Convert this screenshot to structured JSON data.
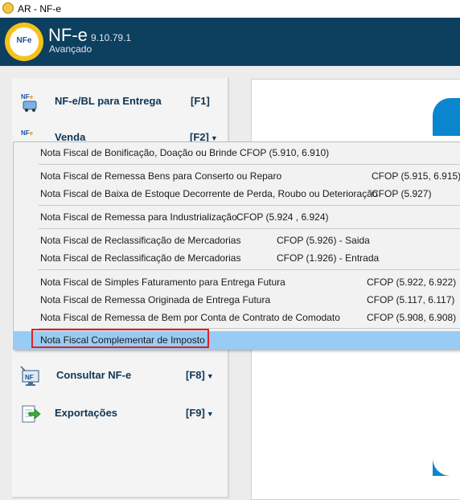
{
  "window": {
    "title": "AR - NF-e"
  },
  "header": {
    "app_name": "NF-e",
    "version": "9.10.79.1",
    "subtitle": "Avançado",
    "logo_text": "NFe"
  },
  "sidebar": {
    "items": [
      {
        "label": "NF-e/BL para Entrega",
        "key": "[F1]",
        "icon": "nfe-delivery-icon"
      },
      {
        "label": "Venda",
        "key": "[F2]",
        "icon": "nfe-sale-icon"
      },
      {
        "label": "Consultar NF-e",
        "key": "[F8]",
        "icon": "nfe-query-icon"
      },
      {
        "label": "Exportações",
        "key": "[F9]",
        "icon": "export-icon"
      }
    ]
  },
  "menu": {
    "items": [
      {
        "name": "Nota Fiscal de Bonificação, Doação ou Brinde",
        "cfop": "CFOP (5.910, 6.910)"
      },
      {
        "name": "Nota Fiscal de Remessa Bens para Conserto ou Reparo",
        "cfop": "CFOP (5.915, 6.915)"
      },
      {
        "name": "Nota Fiscal de Baixa de Estoque Decorrente de Perda, Roubo ou Deterioração",
        "cfop": "CFOP (5.927)"
      },
      {
        "name": "Nota Fiscal de Remessa para Industrialização",
        "cfop": "CFOP (5.924 , 6.924)"
      },
      {
        "name": "Nota Fiscal de Reclassificação de Mercadorias",
        "cfop": "CFOP (5.926) - Saida"
      },
      {
        "name": "Nota Fiscal de Reclassificação de Mercadorias",
        "cfop": "CFOP (1.926) - Entrada"
      },
      {
        "name": "Nota Fiscal de Simples Faturamento para Entrega Futura",
        "cfop": "CFOP (5.922, 6.922)"
      },
      {
        "name": "Nota Fiscal de Remessa Originada de Entrega Futura",
        "cfop": "CFOP (5.117, 6.117)"
      },
      {
        "name": "Nota Fiscal de Remessa de Bem por Conta de Contrato de Comodato",
        "cfop": "CFOP (5.908, 6.908)"
      },
      {
        "name": "Nota Fiscal Complementar de Imposto",
        "cfop": ""
      }
    ],
    "highlighted_index": 9
  },
  "colors": {
    "header": "#0d3f5f",
    "accent": "#0a86cf",
    "highlight": "#99ccf5",
    "focus_border": "#e02020"
  }
}
